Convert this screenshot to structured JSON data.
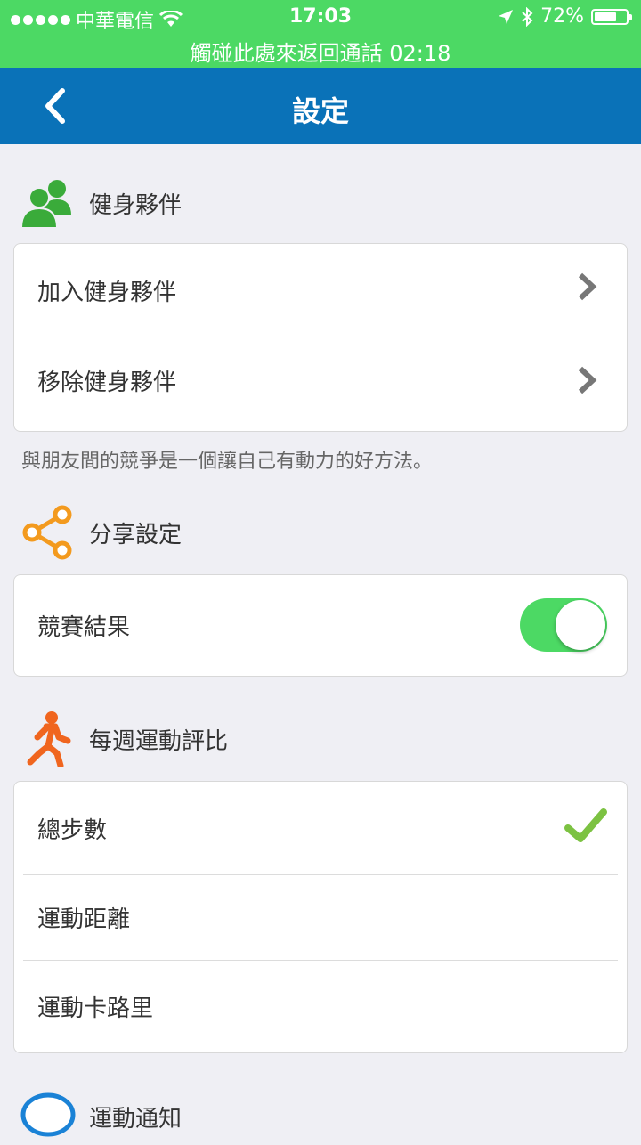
{
  "status_bar": {
    "carrier": "中華電信",
    "time": "17:03",
    "battery": "72%",
    "battery_level": 0.72,
    "call_banner": "觸碰此處來返回通話 02:18"
  },
  "nav": {
    "title": "設定"
  },
  "sections": {
    "partners": {
      "title": "健身夥伴",
      "items": [
        "加入健身夥伴",
        "移除健身夥伴"
      ],
      "note": "與朋友間的競爭是一個讓自己有動力的好方法。"
    },
    "share": {
      "title": "分享設定",
      "items": [
        "競賽結果"
      ],
      "toggle_on": true
    },
    "weekly": {
      "title": "每週運動評比",
      "items": [
        "總步數",
        "運動距離",
        "運動卡路里"
      ],
      "selected": "總步數"
    },
    "notify": {
      "title": "運動通知"
    }
  },
  "colors": {
    "status_green": "#4cd964",
    "nav_blue": "#0a72b8",
    "partner_green": "#3aab3a",
    "share_orange": "#f39a1e",
    "runner_orange": "#f0651e",
    "check_green": "#7cc242",
    "bubble_blue": "#1a82d6"
  }
}
